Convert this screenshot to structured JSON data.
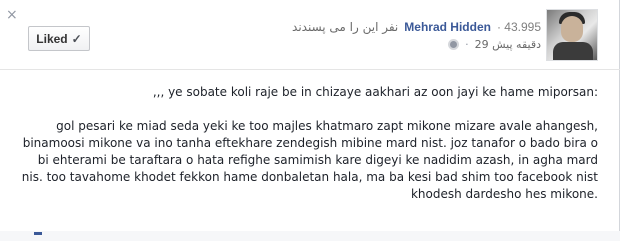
{
  "header": {
    "close_glyph": "×",
    "liked_label": "Liked",
    "liked_check": "✓",
    "count": "· 43.995",
    "author": "Mehrad Hidden",
    "like_text": "نفر این را می پسندند",
    "timestamp": "29 دقیقه پیش",
    "separator": "·"
  },
  "post": {
    "first_line": ",,, ye sobate koli raje be in chizaye aakhari az oon jayi ke hame miporsan:",
    "body": "gol pesari ke miad seda yeki ke too majles khatmaro zapt mikone mizare avale ahangesh, binamoosi mikone va ino tanha eftekhare zendegish mibine mard nist. joz tanafor o bado bira o bi ehterami be taraftara o hata refighe samimish kare digeyi ke nadidim azash, in agha mard nis. too tavahome khodet fekkon hame donbaletan hala, ma ba kesi bad shim too facebook nist khodesh dardesho hes mikone."
  },
  "icons": {
    "close": "close-icon",
    "check": "check-icon",
    "globe": "globe-icon",
    "avatar": "avatar"
  },
  "colors": {
    "link": "#3b5998",
    "meta": "#6a6a6a",
    "text": "#1d2129"
  }
}
